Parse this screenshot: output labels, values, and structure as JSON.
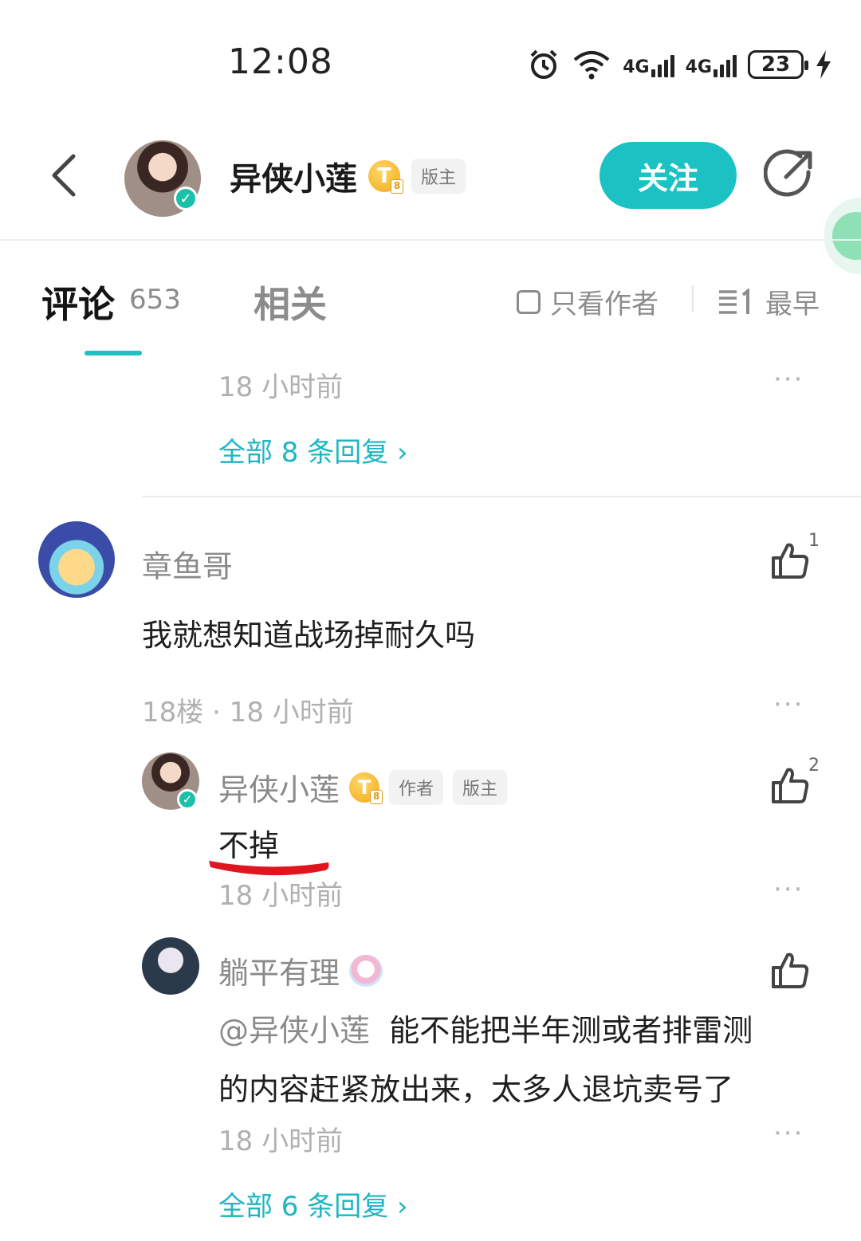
{
  "status_bar": {
    "time": "12:08",
    "network_1": "4G",
    "network_2": "4G",
    "battery": "23"
  },
  "header": {
    "username": "异侠小莲",
    "badge_letter": "T",
    "role_tag": "版主",
    "follow_label": "关注"
  },
  "tabs": {
    "comments_label": "评论",
    "comments_count": "653",
    "related_label": "相关",
    "author_only_label": "只看作者",
    "sort_label": "最早"
  },
  "prev_comment": {
    "time": "18 小时前",
    "more": "···",
    "replies_link": "全部 8 条回复 ›"
  },
  "comment": {
    "username": "章鱼哥",
    "likes": "1",
    "text": "我就想知道战场掉耐久吗",
    "meta": "18楼 · 18 小时前",
    "more": "···"
  },
  "reply1": {
    "username": "异侠小莲",
    "badge_letter": "T",
    "tag_author": "作者",
    "tag_mod": "版主",
    "likes": "2",
    "text": "不掉",
    "time": "18 小时前",
    "more": "···"
  },
  "reply2": {
    "username": "躺平有理",
    "mention": "@异侠小莲",
    "text_line1": "能不能把半年测或者排雷测",
    "text_line2": "的内容赶紧放出来，太多人退坑卖号了",
    "time": "18 小时前",
    "more": "···",
    "replies_link": "全部 6 条回复 ›"
  },
  "colors": {
    "accent": "#1cc1c4",
    "link": "#1cb6c2",
    "verify": "#1cbfa7",
    "annotation": "#e0151f"
  }
}
